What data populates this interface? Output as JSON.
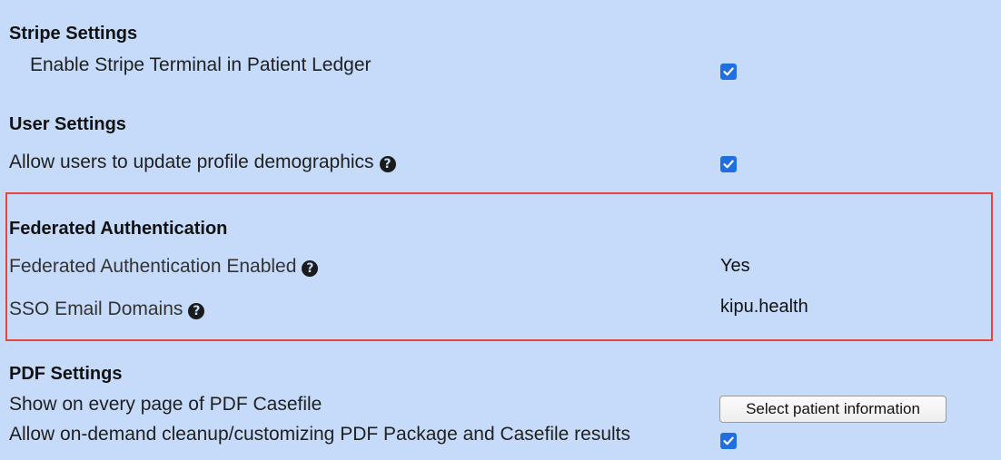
{
  "stripe": {
    "heading": "Stripe Settings",
    "terminal_label": "Enable Stripe Terminal in Patient Ledger",
    "terminal_checked": true
  },
  "user": {
    "heading": "User Settings",
    "demographics_label": "Allow users to update profile demographics",
    "demographics_checked": true
  },
  "federated": {
    "heading": "Federated Authentication",
    "enabled_label": "Federated Authentication Enabled",
    "enabled_value": "Yes",
    "sso_label": "SSO Email Domains",
    "sso_value": "kipu.health"
  },
  "pdf": {
    "heading": "PDF Settings",
    "every_page_label": "Show on every page of PDF Casefile",
    "select_button_label": "Select patient information",
    "cleanup_label": "Allow on-demand cleanup/customizing PDF Package and Casefile results",
    "cleanup_checked": true
  },
  "icons": {
    "help": "question-circle-icon",
    "checkbox": "checked-checkbox-icon"
  },
  "colors": {
    "background": "#c6dbf9",
    "highlight_border": "#e5463b",
    "checkbox": "#1f6fe0"
  }
}
